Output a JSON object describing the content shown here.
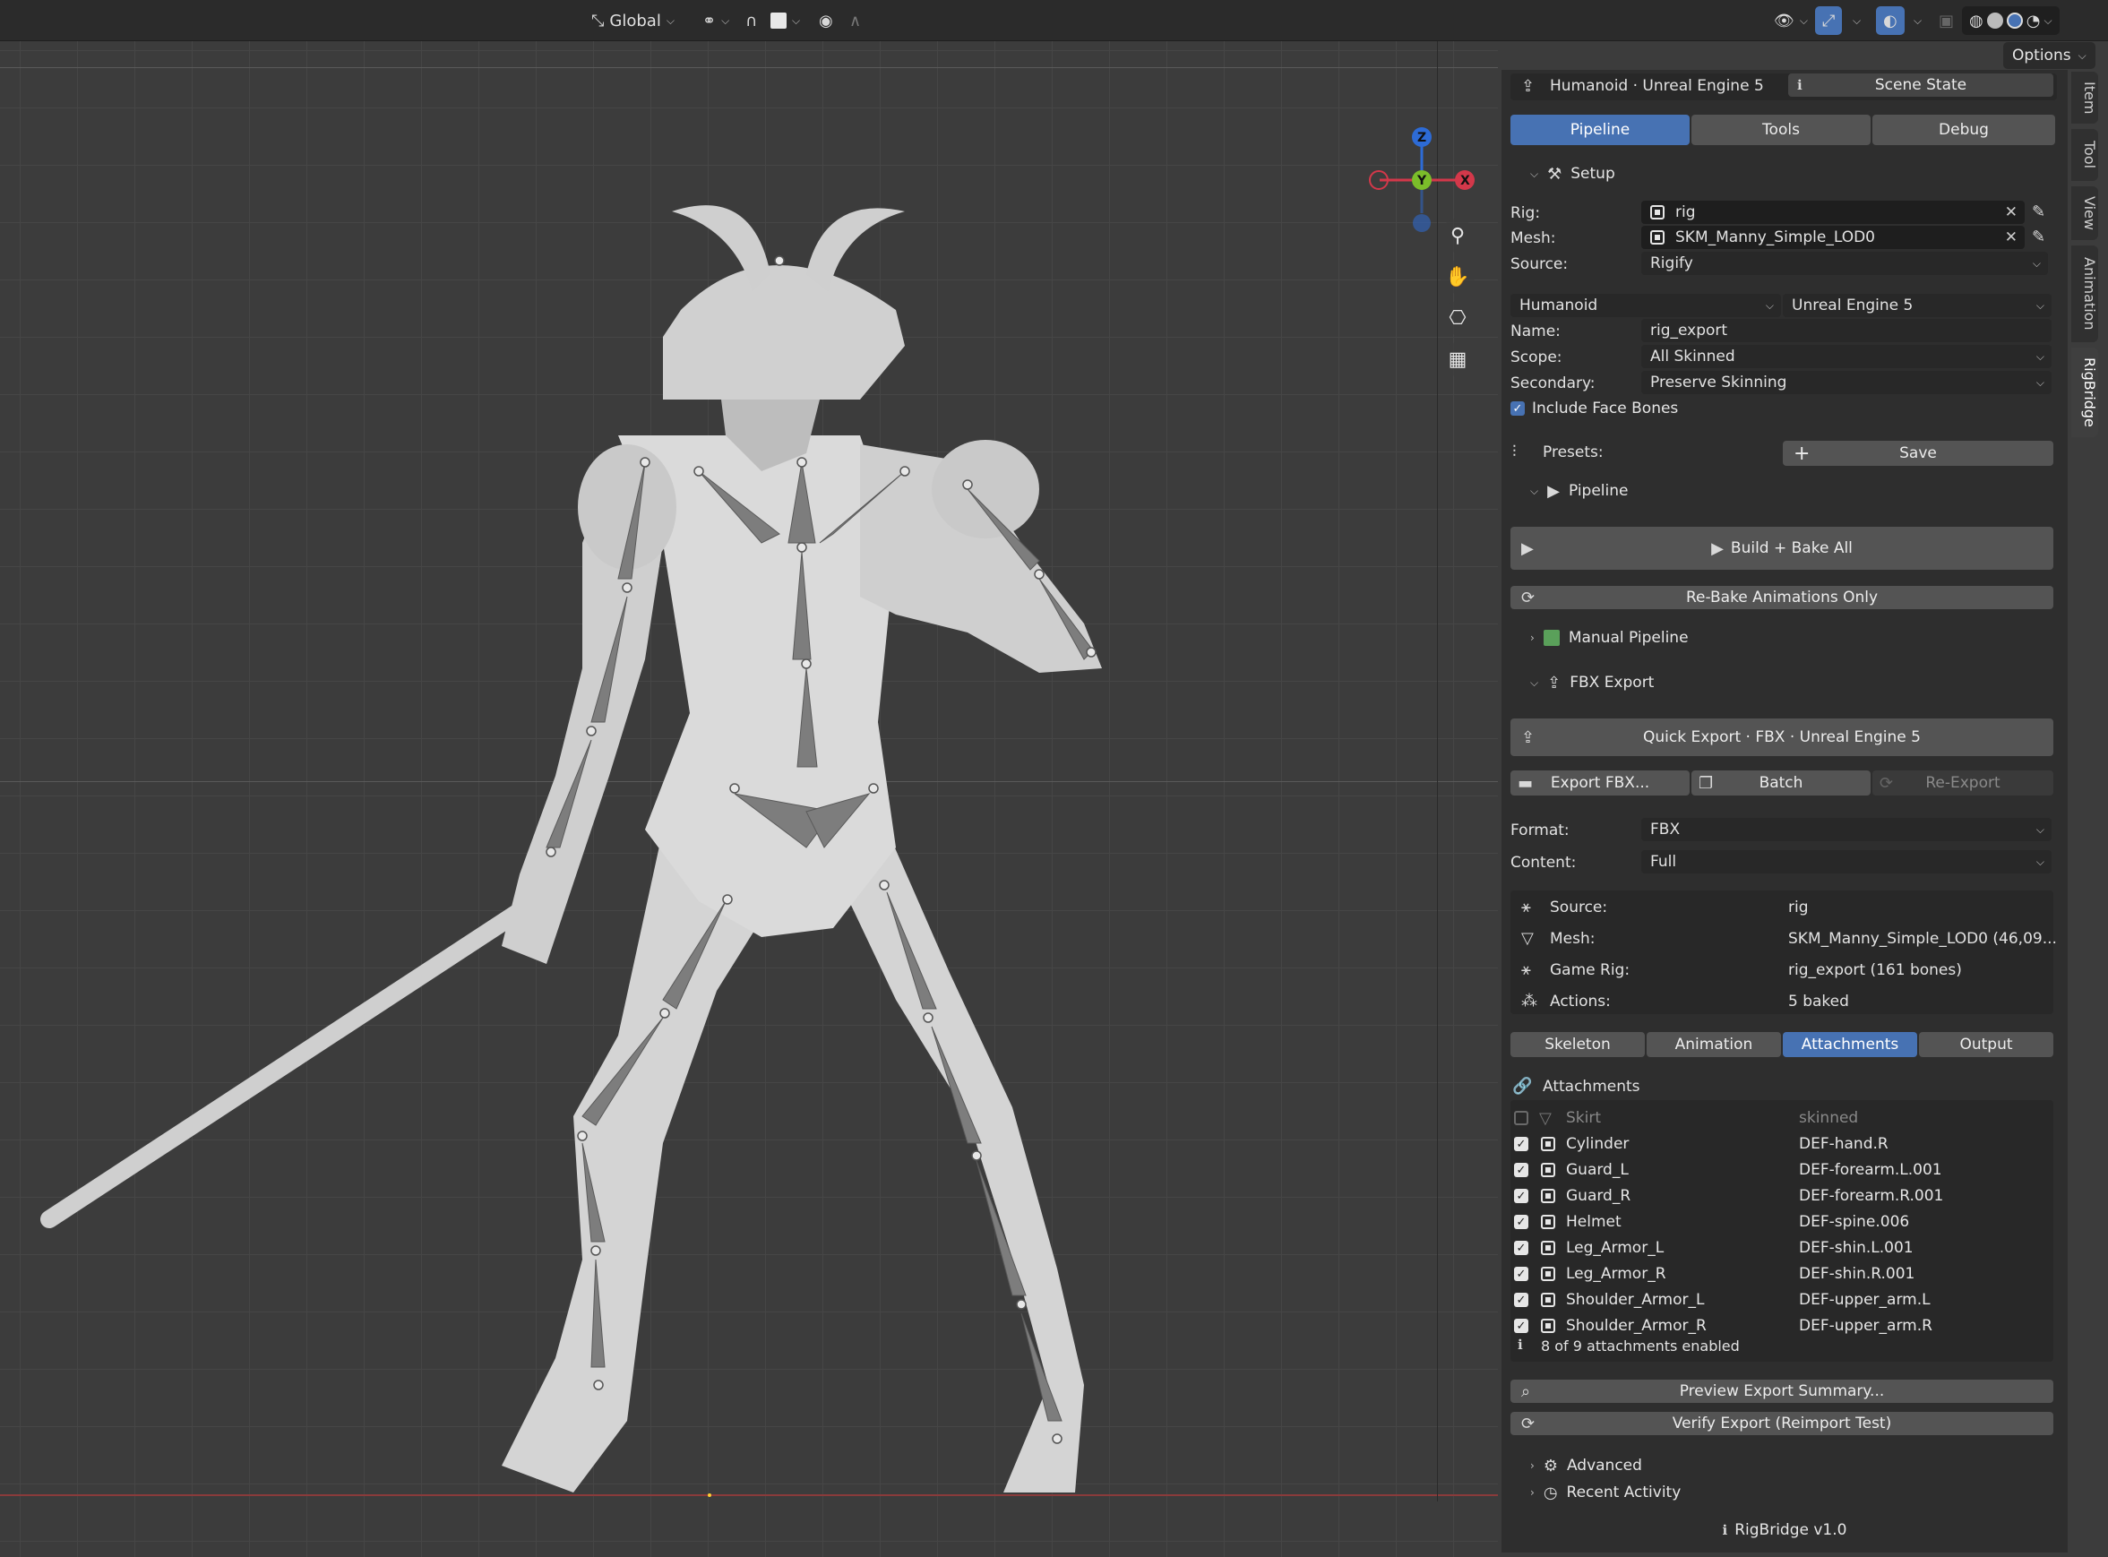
{
  "header": {
    "orientation": "Global",
    "options_label": "Options"
  },
  "viewport": {
    "gizmo": {
      "z": "Z",
      "y": "Y",
      "x": "X"
    }
  },
  "side_tabs": [
    "Item",
    "Tool",
    "View",
    "Animation",
    "RigBridge"
  ],
  "panel": {
    "top": {
      "label": "Humanoid · Unreal Engine 5",
      "scene_state": "Scene State"
    },
    "tabs": [
      "Pipeline",
      "Tools",
      "Debug"
    ],
    "setup": {
      "title": "Setup",
      "rig_label": "Rig:",
      "rig_value": "rig",
      "mesh_label": "Mesh:",
      "mesh_value": "SKM_Manny_Simple_LOD0",
      "source_label": "Source:",
      "source_value": "Rigify",
      "profile": "Humanoid",
      "engine": "Unreal Engine 5",
      "name_label": "Name:",
      "name_value": "rig_export",
      "scope_label": "Scope:",
      "scope_value": "All Skinned",
      "secondary_label": "Secondary:",
      "secondary_value": "Preserve Skinning",
      "face_bones": "Include Face Bones",
      "presets_label": "Presets:",
      "save_label": "Save"
    },
    "pipeline": {
      "title": "Pipeline",
      "build_bake": "Build + Bake All",
      "rebake": "Re-Bake Animations Only",
      "manual": "Manual Pipeline"
    },
    "fbx": {
      "title": "FBX Export",
      "quick_export": "Quick Export · FBX · Unreal Engine 5",
      "export_fbx": "Export FBX...",
      "batch": "Batch",
      "reexport": "Re-Export",
      "format_label": "Format:",
      "format_value": "FBX",
      "content_label": "Content:",
      "content_value": "Full"
    },
    "summary": [
      {
        "label": "Source:",
        "value": "rig"
      },
      {
        "label": "Mesh:",
        "value": "SKM_Manny_Simple_LOD0  (46,09..."
      },
      {
        "label": "Game Rig:",
        "value": "rig_export  (161 bones)"
      },
      {
        "label": "Actions:",
        "value": "5 baked"
      }
    ],
    "subtabs": [
      "Skeleton",
      "Animation",
      "Attachments",
      "Output"
    ],
    "attachments": {
      "title": "Attachments",
      "rows": [
        {
          "name": "Skirt",
          "bone": "skinned"
        },
        {
          "name": "Cylinder",
          "bone": "DEF-hand.R"
        },
        {
          "name": "Guard_L",
          "bone": "DEF-forearm.L.001"
        },
        {
          "name": "Guard_R",
          "bone": "DEF-forearm.R.001"
        },
        {
          "name": "Helmet",
          "bone": "DEF-spine.006"
        },
        {
          "name": "Leg_Armor_L",
          "bone": "DEF-shin.L.001"
        },
        {
          "name": "Leg_Armor_R",
          "bone": "DEF-shin.R.001"
        },
        {
          "name": "Shoulder_Armor_L",
          "bone": "DEF-upper_arm.L"
        },
        {
          "name": "Shoulder_Armor_R",
          "bone": "DEF-upper_arm.R"
        }
      ],
      "status": "8 of 9 attachments enabled"
    },
    "preview": "Preview Export Summary...",
    "verify": "Verify Export (Reimport Test)",
    "advanced": "Advanced",
    "recent": "Recent Activity",
    "footer": "RigBridge  v1.0"
  }
}
